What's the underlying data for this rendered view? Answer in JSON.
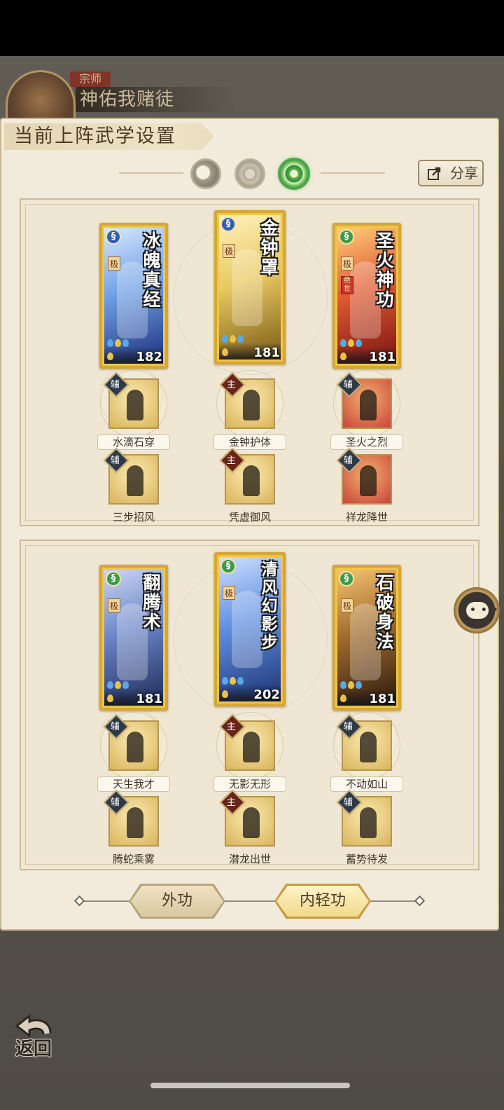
{
  "background": {
    "rank_tag": "宗师",
    "player_name": "神佑我赌徒"
  },
  "panel": {
    "title": "当前上阵武学设置",
    "share_label": "分享",
    "modes": [
      "moon-mode-icon",
      "sun-mode-icon",
      "jade-mode-icon"
    ],
    "selected_mode": "jade-mode-icon"
  },
  "groups": [
    {
      "cards": [
        {
          "title": "冰魄真经",
          "rank": "极",
          "power": "182",
          "school_icon": "blue-swirl-icon",
          "art": [
            "#1b2f7a",
            "#6fa0e6",
            "#d6e8ff"
          ]
        },
        {
          "title": "金钟罩",
          "rank": "极",
          "power": "181",
          "school_icon": "blue-swirl-icon",
          "art": [
            "#7a5a14",
            "#e8c860",
            "#fff2c0"
          ]
        },
        {
          "title": "圣火神功",
          "rank": "极",
          "rank2": "绝世",
          "power": "181",
          "school_icon": "green-swirl-icon",
          "art": [
            "#7a1410",
            "#e05a32",
            "#ffcf7a"
          ]
        }
      ],
      "skills": [
        [
          {
            "badge": "辅",
            "type": "assist",
            "name": "水滴石穿"
          },
          {
            "badge": "辅",
            "type": "assist",
            "name": "三步招风"
          }
        ],
        [
          {
            "badge": "主",
            "type": "main",
            "name": "金钟护体"
          },
          {
            "badge": "主",
            "type": "main",
            "name": "凭虚御风"
          }
        ],
        [
          {
            "badge": "辅",
            "type": "assist",
            "name": "圣火之烈"
          },
          {
            "badge": "辅",
            "type": "assist",
            "name": "祥龙降世"
          }
        ]
      ]
    },
    {
      "cards": [
        {
          "title": "翻腾术",
          "rank": "极",
          "power": "181",
          "school_icon": "green-swirl-icon",
          "art": [
            "#1c2a55",
            "#6b84c8",
            "#c9d6f2"
          ]
        },
        {
          "title": "清风幻影步",
          "rank": "极",
          "power": "202",
          "school_icon": "green-swirl-icon",
          "art": [
            "#1c3270",
            "#5e8ee0",
            "#cde0ff"
          ]
        },
        {
          "title": "石破身法",
          "rank": "极",
          "power": "181",
          "school_icon": "green-swirl-icon",
          "art": [
            "#2a1a0e",
            "#a06a2c",
            "#f5c470"
          ]
        }
      ],
      "skills": [
        [
          {
            "badge": "辅",
            "type": "assist",
            "name": "天生我才"
          },
          {
            "badge": "辅",
            "type": "assist",
            "name": "腾蛇乘雾"
          }
        ],
        [
          {
            "badge": "主",
            "type": "main",
            "name": "无影无形"
          },
          {
            "badge": "主",
            "type": "main",
            "name": "潜龙出世"
          }
        ],
        [
          {
            "badge": "辅",
            "type": "assist",
            "name": "不动如山"
          },
          {
            "badge": "辅",
            "type": "assist",
            "name": "蓄势待发"
          }
        ]
      ]
    }
  ],
  "tabs": [
    {
      "label": "外功",
      "active": false
    },
    {
      "label": "内轻功",
      "active": true
    }
  ],
  "back_label": "返回",
  "colors": {
    "panel_bg": "#f2ebdb",
    "card_gold": "#d6a636",
    "jade_accent": "#3c9b4a"
  }
}
